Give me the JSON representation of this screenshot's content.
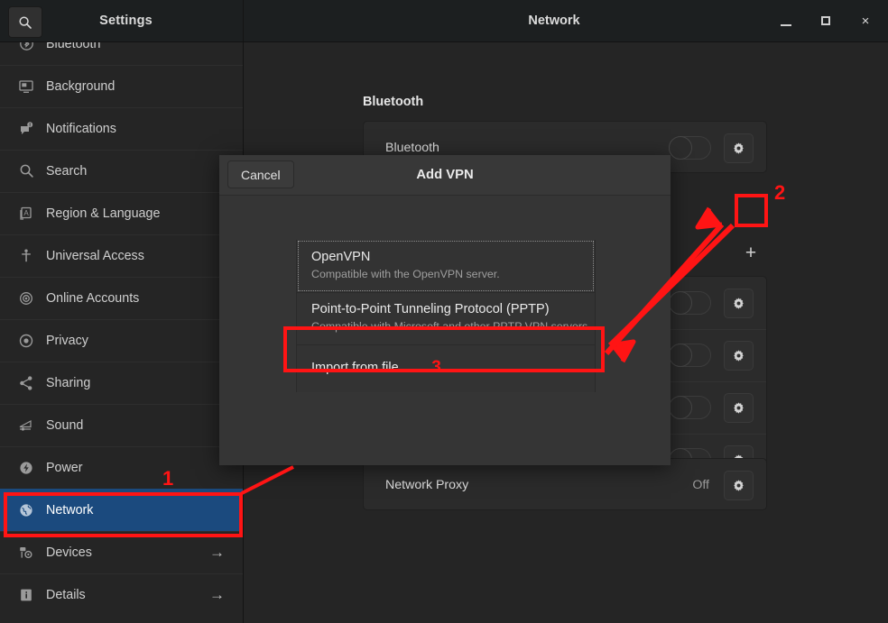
{
  "window": {
    "left_title": "Settings",
    "right_title": "Network",
    "minimize_label": "",
    "maximize_label": "",
    "close_label": "×",
    "search_icon": "search-icon"
  },
  "sidebar": {
    "items": [
      {
        "label": "Bluetooth",
        "icon": "bluetooth-icon",
        "arrow": "",
        "selected": false,
        "clipped": true
      },
      {
        "label": "Background",
        "icon": "background-icon",
        "arrow": "",
        "selected": false
      },
      {
        "label": "Notifications",
        "icon": "notifications-icon",
        "arrow": "",
        "selected": false
      },
      {
        "label": "Search",
        "icon": "search-icon",
        "arrow": "",
        "selected": false
      },
      {
        "label": "Region & Language",
        "icon": "region-language-icon",
        "arrow": "",
        "selected": false
      },
      {
        "label": "Universal Access",
        "icon": "universal-access-icon",
        "arrow": "",
        "selected": false
      },
      {
        "label": "Online Accounts",
        "icon": "online-accounts-icon",
        "arrow": "",
        "selected": false
      },
      {
        "label": "Privacy",
        "icon": "privacy-icon",
        "arrow": "",
        "selected": false
      },
      {
        "label": "Sharing",
        "icon": "sharing-icon",
        "arrow": "",
        "selected": false
      },
      {
        "label": "Sound",
        "icon": "sound-icon",
        "arrow": "",
        "selected": false
      },
      {
        "label": "Power",
        "icon": "power-icon",
        "arrow": "",
        "selected": false
      },
      {
        "label": "Network",
        "icon": "network-icon",
        "arrow": "",
        "selected": true
      },
      {
        "label": "Devices",
        "icon": "devices-icon",
        "arrow": "→",
        "selected": false
      },
      {
        "label": "Details",
        "icon": "details-icon",
        "arrow": "→",
        "selected": false
      }
    ]
  },
  "main": {
    "bluetooth_heading": "Bluetooth",
    "bluetooth_row_label": "Bluetooth",
    "add_vpn_plus_label": "+",
    "vpn_rows": [
      {
        "label": ""
      },
      {
        "label": ""
      },
      {
        "label": ""
      },
      {
        "label": ""
      }
    ],
    "proxy_row": {
      "label": "Network Proxy",
      "value": "Off"
    }
  },
  "dialog": {
    "title": "Add VPN",
    "cancel_label": "Cancel",
    "items": [
      {
        "name": "OpenVPN",
        "desc": "Compatible with the OpenVPN server.",
        "focused": true
      },
      {
        "name": "Point-to-Point Tunneling Protocol (PPTP)",
        "desc": "Compatible with Microsoft and other PPTP VPN servers.",
        "focused": false
      }
    ],
    "import_item": {
      "name": "Import from file…",
      "step": "3"
    }
  },
  "annotations": {
    "step1": "1",
    "step2": "2",
    "step3": "3",
    "color": "#ff1414"
  },
  "colors": {
    "accent_selected": "#1b4a7e",
    "annotation_red": "#ff1414",
    "window_bg": "#252525",
    "titlebar_bg": "#1c1f20",
    "dialog_bg": "#353535"
  }
}
